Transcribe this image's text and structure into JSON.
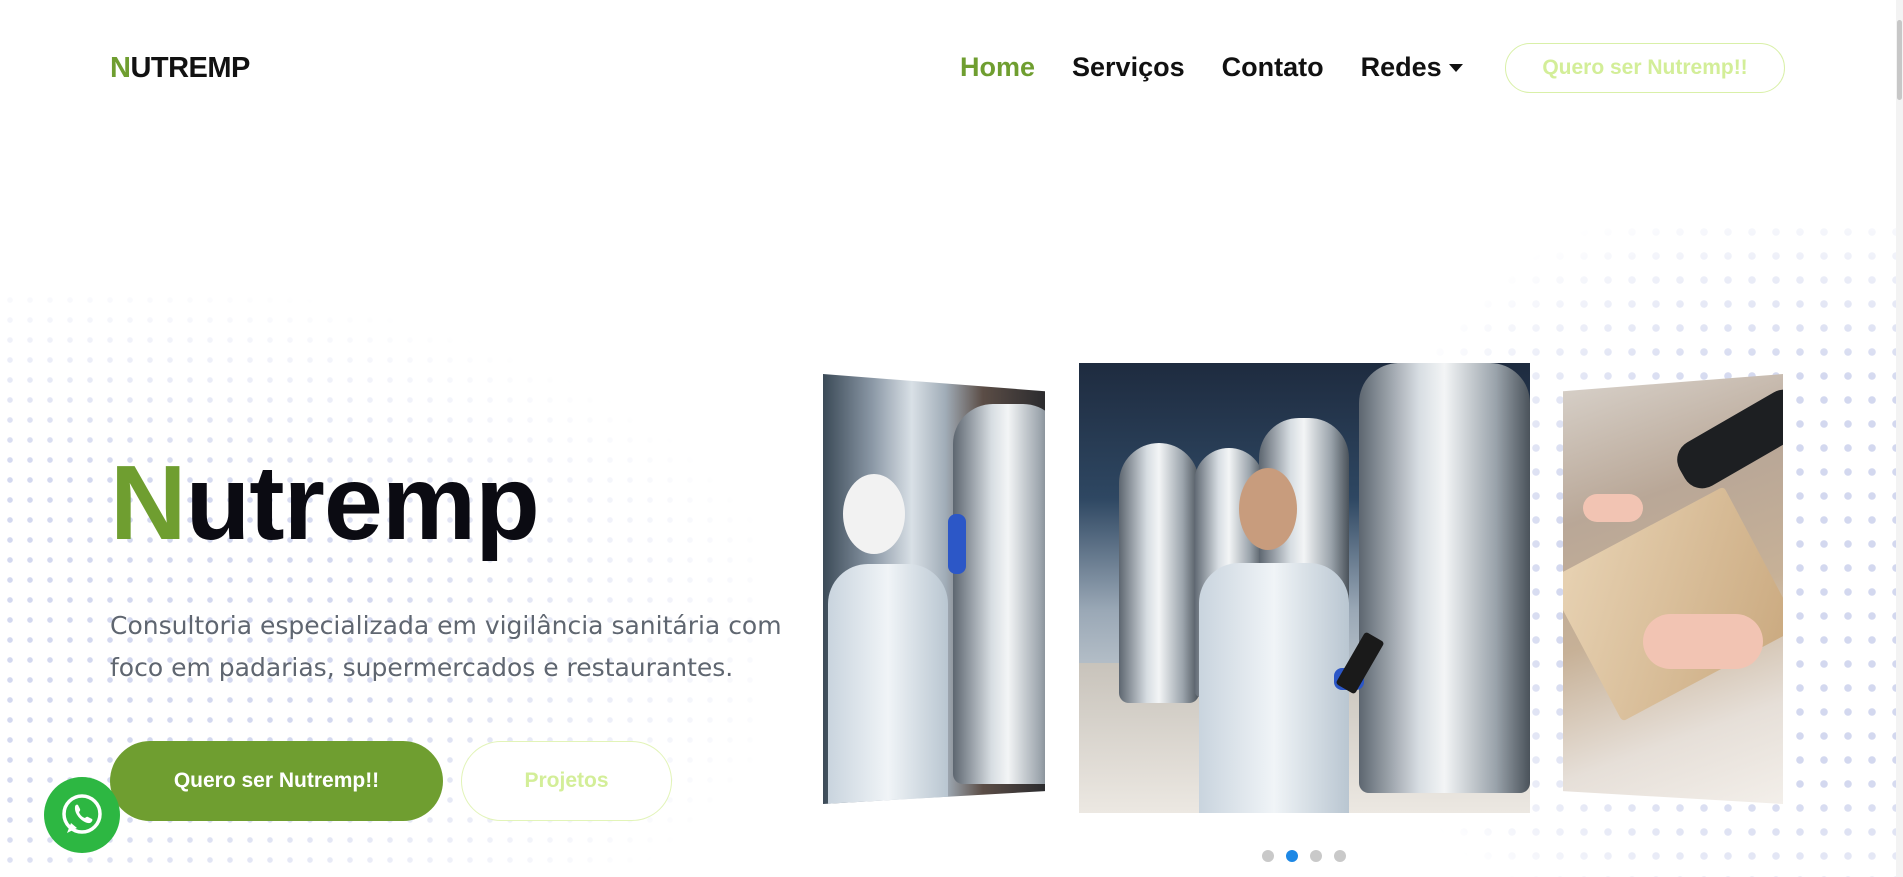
{
  "header": {
    "logo": {
      "first_letter": "N",
      "rest": "UTREMP"
    },
    "nav": [
      {
        "label": "Home",
        "active": true
      },
      {
        "label": "Serviços",
        "active": false
      },
      {
        "label": "Contato",
        "active": false
      },
      {
        "label": "Redes",
        "active": false,
        "dropdown": true
      }
    ],
    "cta_label": "Quero ser Nutremp!!"
  },
  "hero": {
    "title_first_letter": "N",
    "title_rest": "utremp",
    "description": "Consultoria especializada em vigilância sanitária com foco em padarias, supermercados e restaurantes.",
    "primary_button": "Quero ser Nutremp!!",
    "secondary_button": "Projetos"
  },
  "carousel": {
    "slides_count": 4,
    "active_index": 1,
    "slides": [
      {
        "subject": "worker-with-mask-at-tank"
      },
      {
        "subject": "worker-with-tablet-in-brewery"
      },
      {
        "subject": "hands-reading-document"
      }
    ]
  },
  "floating": {
    "whatsapp_icon": "whatsapp-icon"
  },
  "colors": {
    "brand_green": "#6f9e30",
    "light_green_text": "#d3ee98",
    "indicator_active": "#1e88e5",
    "whatsapp_green": "#2db742"
  }
}
